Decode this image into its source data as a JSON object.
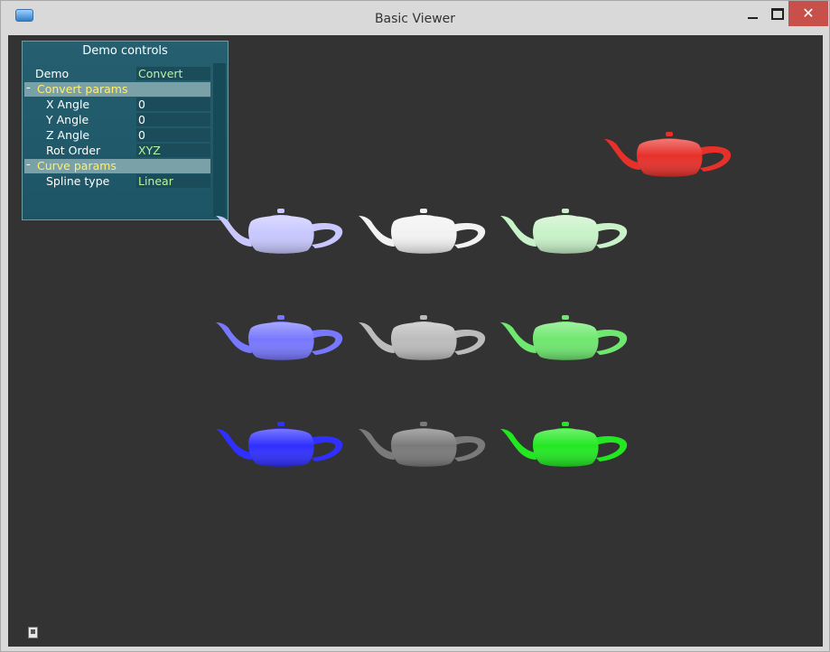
{
  "window": {
    "title": "Basic Viewer",
    "close_glyph": "✕"
  },
  "panel": {
    "title": "Demo controls",
    "rows": [
      {
        "type": "item",
        "label": "Demo",
        "value": "Convert",
        "value_color": "green"
      },
      {
        "type": "group",
        "label": "Convert params"
      },
      {
        "type": "item",
        "label": "X Angle",
        "value": "0"
      },
      {
        "type": "item",
        "label": "Y Angle",
        "value": "0"
      },
      {
        "type": "item",
        "label": "Z Angle",
        "value": "0"
      },
      {
        "type": "item",
        "label": "Rot Order",
        "value": "XYZ",
        "value_color": "green"
      },
      {
        "type": "group",
        "label": "Curve params"
      },
      {
        "type": "item",
        "label": "Spline type",
        "value": "Linear",
        "value_color": "green"
      }
    ]
  },
  "scene": {
    "teapots": [
      {
        "name": "red",
        "color": "#e8302a"
      },
      {
        "name": "light-blue",
        "color": "#c8c8ff"
      },
      {
        "name": "white",
        "color": "#f2f2f2"
      },
      {
        "name": "light-green",
        "color": "#c8f2c8"
      },
      {
        "name": "mid-blue",
        "color": "#7878ff"
      },
      {
        "name": "light-gray",
        "color": "#bcbcbc"
      },
      {
        "name": "mid-green",
        "color": "#6fe86f"
      },
      {
        "name": "blue",
        "color": "#2f2fff"
      },
      {
        "name": "dark-gray",
        "color": "#7a7a7a"
      },
      {
        "name": "green",
        "color": "#22e822"
      }
    ]
  },
  "icons": {
    "app": "app-icon",
    "status": "status-icon"
  }
}
